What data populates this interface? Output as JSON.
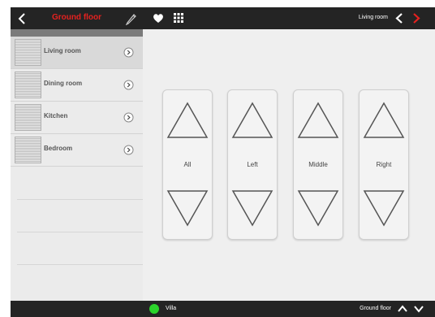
{
  "sidebar": {
    "title": "Ground floor",
    "rooms": [
      {
        "label": "Living room"
      },
      {
        "label": "Dining room"
      },
      {
        "label": "Kitchen"
      },
      {
        "label": "Bedroom"
      }
    ],
    "selected_room": "Living room"
  },
  "header": {
    "current_room": "Living room"
  },
  "controls": [
    {
      "label": "All"
    },
    {
      "label": "Left"
    },
    {
      "label": "Middle"
    },
    {
      "label": "Right"
    }
  ],
  "footer": {
    "house": "Villa",
    "floor": "Ground floor",
    "status_color": "#2bd32b"
  },
  "colors": {
    "accent": "#e5211f",
    "bar": "#242424"
  },
  "icons": [
    "back-icon",
    "pencil-icon",
    "chevron-right-circle-icon",
    "heart-icon",
    "grid-icon",
    "chevron-left-icon",
    "chevron-right-icon",
    "chevron-up-icon",
    "chevron-down-icon",
    "triangle-up-icon",
    "triangle-down-icon"
  ]
}
